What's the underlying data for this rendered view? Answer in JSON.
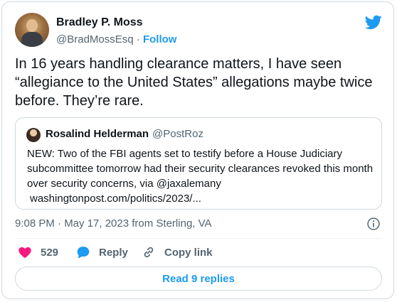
{
  "author": {
    "name": "Bradley P. Moss",
    "handle": "@BradMossEsq",
    "separator": "·",
    "follow_label": "Follow"
  },
  "tweet": {
    "text": "In 16 years handling clearance matters, I have seen “allegiance to the United States” allegations maybe twice before. They’re rare."
  },
  "quote": {
    "name": "Rosalind Helderman",
    "handle": "@PostRoz",
    "text": "NEW: Two of the FBI agents set to testify before a House Judiciary subcommittee tomorrow had their security clearances revoked this month over security concerns, via @jaxalemany",
    "link": "washingtonpost.com/politics/2023/..."
  },
  "meta": {
    "timestamp": "9:08 PM · May 17, 2023 from Sterling, VA"
  },
  "actions": {
    "like_count": "529",
    "reply_label": "Reply",
    "copy_label": "Copy link",
    "read_replies_label": "Read 9 replies"
  },
  "icons": {
    "brand": "twitter-bird-icon",
    "like": "heart-icon",
    "reply": "speech-bubble-icon",
    "copy": "link-icon",
    "info": "info-icon"
  },
  "colors": {
    "accent": "#1d9bf0",
    "like": "#f91880",
    "text": "#0f1419",
    "muted": "#536471",
    "border": "#cfd9de"
  }
}
